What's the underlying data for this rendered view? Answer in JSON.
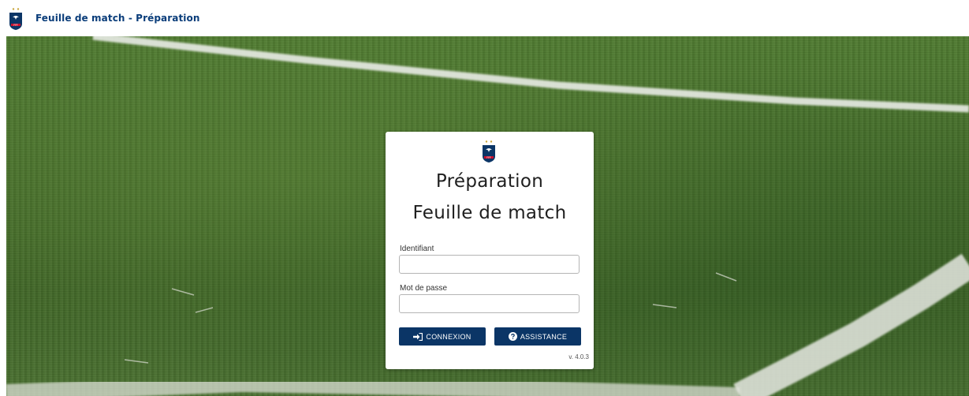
{
  "header": {
    "title": "Feuille de match - Préparation",
    "logo_icon": "fff-crest-icon"
  },
  "login": {
    "logo_icon": "fff-crest-icon",
    "heading_line1": "Préparation",
    "heading_line2": "Feuille de match",
    "username_label": "Identifiant",
    "username_value": "",
    "password_label": "Mot de passe",
    "password_value": "",
    "connexion_label": "CONNEXION",
    "connexion_icon": "sign-in-icon",
    "assistance_label": "ASSISTANCE",
    "assistance_icon": "question-circle-icon",
    "version": "v. 4.0.3"
  },
  "colors": {
    "brand_blue": "#0b3566",
    "title_blue": "#0a3d7a",
    "field_green": "#456d2a"
  }
}
